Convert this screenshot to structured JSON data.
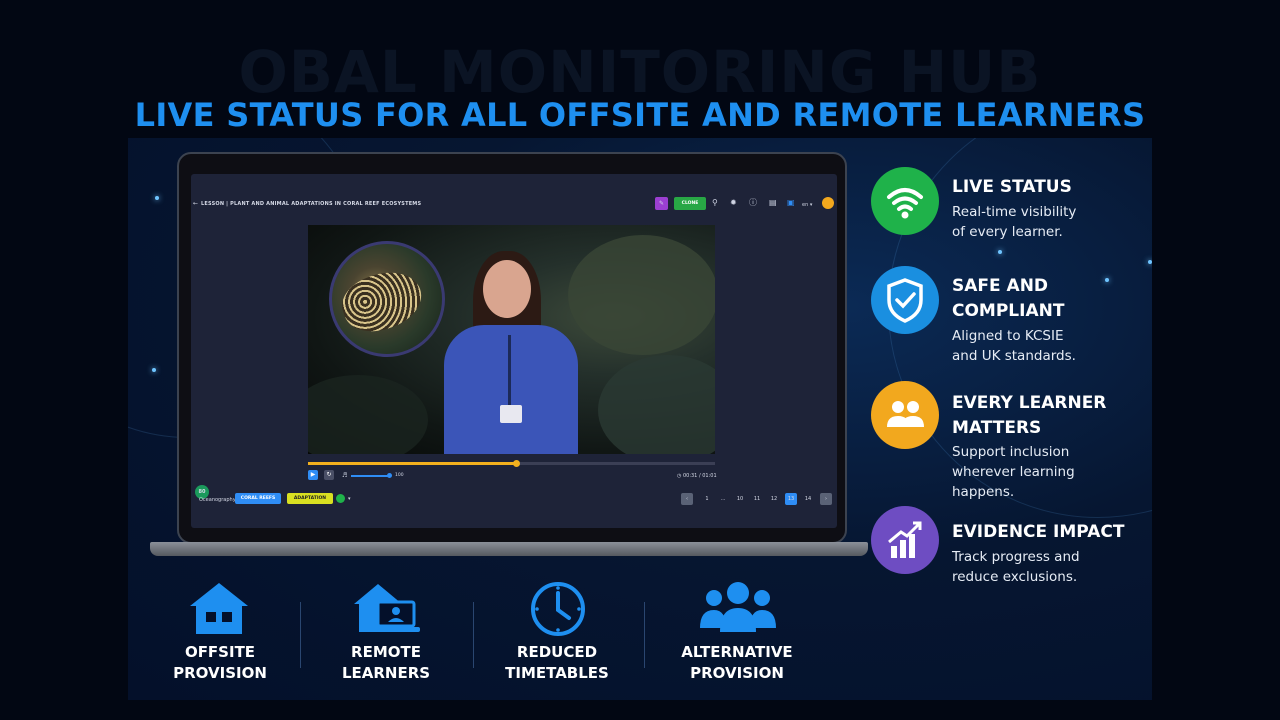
{
  "header": {
    "ghost_title": "OBAL MONITORING HUB",
    "title": "LIVE STATUS FOR ALL OFFSITE AND REMOTE LEARNERS"
  },
  "app": {
    "back_icon": "arrow-left-icon",
    "breadcrumb_section": "LESSON",
    "breadcrumb_title": "PLANT AND ANIMAL ADAPTATIONS IN CORAL REEF ECOSYSTEMS",
    "clone_label": "CLONE",
    "language": "en",
    "video": {
      "progress_fraction": 0.51,
      "volume_label": "100",
      "time": "00:31 / 01:01"
    },
    "bottom": {
      "avatar_initials": "80",
      "category": "Oceanography",
      "tags": [
        "CORAL REEFS",
        "ADAPTATION"
      ],
      "pages": [
        "1",
        "...",
        "10",
        "11",
        "12",
        "13",
        "14"
      ],
      "active_page": "13"
    }
  },
  "features": [
    {
      "title_lines": [
        "LIVE STATUS"
      ],
      "desc_lines": [
        "Real-time visibility",
        "of every learner."
      ],
      "color": "#1fb24a",
      "icon": "wifi-icon"
    },
    {
      "title_lines": [
        "SAFE AND",
        "COMPLIANT"
      ],
      "desc_lines": [
        "Aligned to KCSIE",
        "and UK standards."
      ],
      "color": "#1a8fe0",
      "icon": "shield-check-icon"
    },
    {
      "title_lines": [
        "EVERY LEARNER",
        "MATTERS"
      ],
      "desc_lines": [
        "Support inclusion",
        "wherever learning",
        "happens."
      ],
      "color": "#f2a81e",
      "icon": "people-icon"
    },
    {
      "title_lines": [
        "EVIDENCE IMPACT"
      ],
      "desc_lines": [
        "Track progress and",
        "reduce exclusions."
      ],
      "color": "#6e4dc2",
      "icon": "chart-up-icon"
    }
  ],
  "categories": [
    {
      "lines": [
        "OFFSITE",
        "PROVISION"
      ],
      "icon": "house-icon"
    },
    {
      "lines": [
        "REMOTE",
        "LEARNERS"
      ],
      "icon": "home-laptop-icon"
    },
    {
      "lines": [
        "REDUCED",
        "TIMETABLES"
      ],
      "icon": "clock-icon"
    },
    {
      "lines": [
        "ALTERNATIVE",
        "PROVISION"
      ],
      "icon": "group-icon"
    }
  ],
  "colors": {
    "accent": "#1e8ff0",
    "clone": "#28a745",
    "progress": "#f2b01e",
    "active_page": "#2f8df5"
  }
}
